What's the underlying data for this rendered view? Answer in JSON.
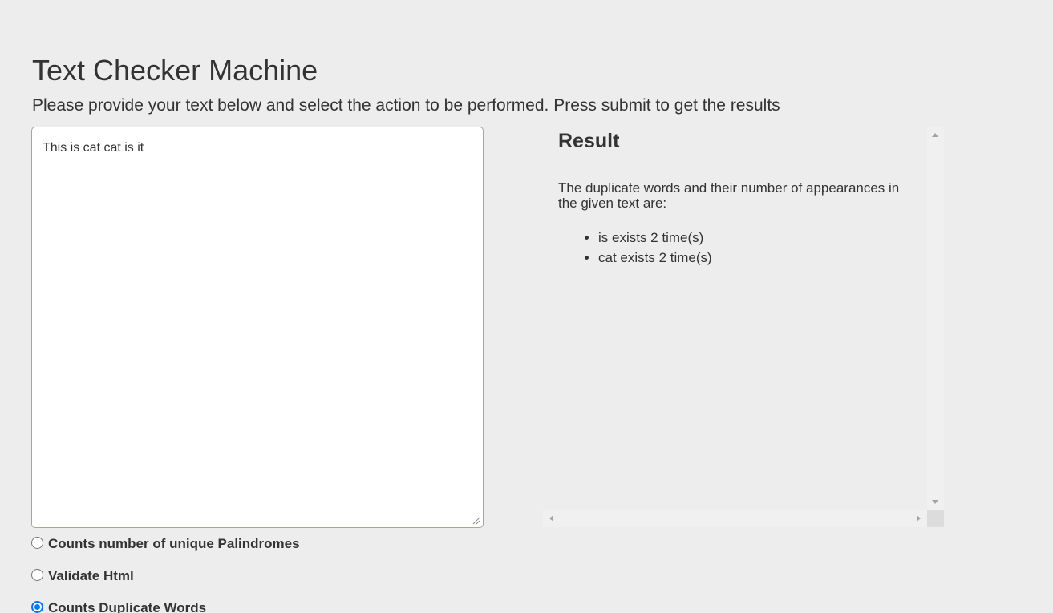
{
  "header": {
    "title": "Text Checker Machine",
    "subtitle": "Please provide your text below and select the action to be performed. Press submit to get the results"
  },
  "input": {
    "text": "This is cat cat is it",
    "placeholder": ""
  },
  "result": {
    "heading": "Result",
    "description": "The duplicate words and their number of appearances in the given text are:",
    "items": [
      "is exists 2 time(s)",
      "cat exists 2 time(s)"
    ]
  },
  "options": [
    {
      "label": "Counts number of unique Palindromes",
      "checked": false
    },
    {
      "label": "Validate Html",
      "checked": false
    },
    {
      "label": "Counts Duplicate Words",
      "checked": true
    }
  ],
  "colors": {
    "background": "#ededed",
    "text": "#333333",
    "radio_checked": "#0075ff",
    "textarea_border": "#a8a88a"
  }
}
